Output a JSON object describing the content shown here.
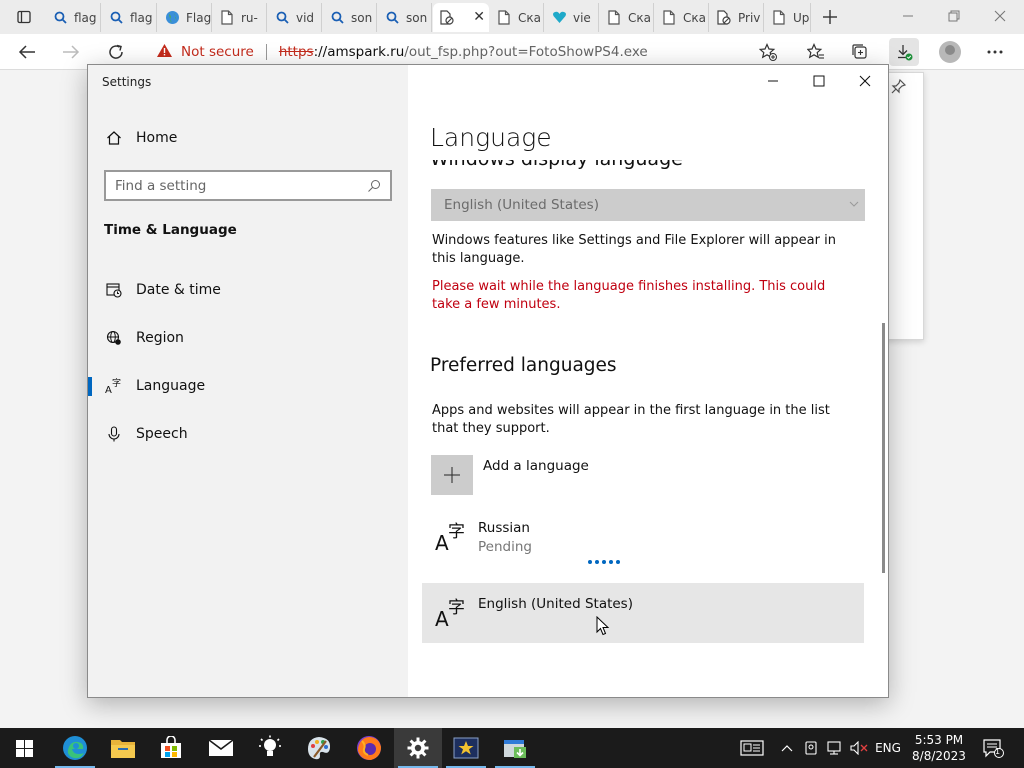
{
  "browser": {
    "tabs": [
      {
        "label": "flag",
        "icon": "search-icon"
      },
      {
        "label": "flag",
        "icon": "search-icon"
      },
      {
        "label": "Flag",
        "icon": "globe-icon"
      },
      {
        "label": "ru-",
        "icon": "page-icon"
      },
      {
        "label": "vid",
        "icon": "search-icon"
      },
      {
        "label": "son",
        "icon": "search-icon"
      },
      {
        "label": "son",
        "icon": "search-icon"
      },
      {
        "label": "",
        "icon": "blocked-page-icon"
      },
      {
        "label": "Ска",
        "icon": "page-icon"
      },
      {
        "label": "vie",
        "icon": "heart-icon"
      },
      {
        "label": "Ска",
        "icon": "page-icon"
      },
      {
        "label": "Ска",
        "icon": "page-icon"
      },
      {
        "label": "Priv",
        "icon": "blocked-page-icon"
      },
      {
        "label": "Up",
        "icon": "page-icon"
      }
    ],
    "active_tab_index": 7,
    "address": {
      "warning_label": "Not secure",
      "scheme": "https",
      "host_text": "://amspark.ru",
      "path_text": "/out_fsp.php?out=FotoShowPS4.exe"
    }
  },
  "settings": {
    "window_title": "Settings",
    "home_label": "Home",
    "search_placeholder": "Find a setting",
    "section_heading": "Time & Language",
    "nav_items": [
      {
        "label": "Date & time",
        "icon": "calendar-clock-icon"
      },
      {
        "label": "Region",
        "icon": "globe-region-icon"
      },
      {
        "label": "Language",
        "icon": "language-icon",
        "selected": true
      },
      {
        "label": "Speech",
        "icon": "microphone-icon"
      }
    ],
    "page_title": "Language",
    "clipped_heading": "Windows display language",
    "display_language_value": "English (United States)",
    "display_language_desc": "Windows features like Settings and File Explorer will appear in this language.",
    "install_warning": "Please wait while the language finishes installing. This could take a few minutes.",
    "preferred_heading": "Preferred languages",
    "preferred_desc": "Apps and websites will appear in the first language in the list that they support.",
    "add_language_label": "Add a language",
    "languages": [
      {
        "name": "Russian",
        "status": "Pending"
      },
      {
        "name": "English (United States)",
        "status": ""
      }
    ]
  },
  "taskbar": {
    "apps": [
      "start-icon",
      "edge-icon",
      "file-explorer-icon",
      "store-icon",
      "mail-icon",
      "tips-icon",
      "paint-icon",
      "firefox-icon",
      "settings-icon",
      "fotoshow-icon",
      "installer-icon"
    ],
    "input_language": "ENG",
    "time": "5:53 PM",
    "date": "8/8/2023",
    "notification_count": "1"
  },
  "colors": {
    "accent": "#0067c0",
    "warning_red": "#c00010",
    "sidebar_bg": "#f2f2f2",
    "taskbar_bg": "#1b1b1b"
  }
}
